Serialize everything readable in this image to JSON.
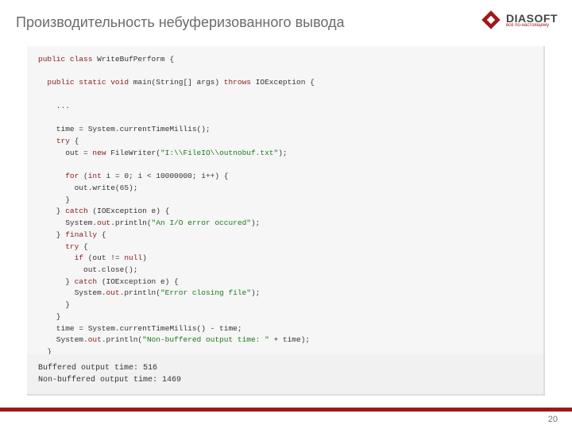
{
  "title": "Производительность небуферизованного вывода",
  "logo": {
    "name": "DIASOFT",
    "tagline": "всё по-настоящему"
  },
  "code": {
    "l01a": "public class",
    "l01b": " WriteBufPerform {",
    "l02a": "  public static void",
    "l02b": " main(String[] args) ",
    "l02c": "throws",
    "l02d": " IOException {",
    "l03": "    ...",
    "l04": "    time = System.currentTimeMillis();",
    "l05a": "    ",
    "l05b": "try",
    "l05c": " {",
    "l06a": "      out = ",
    "l06b": "new",
    "l06c": " FileWriter(",
    "l06d": "\"I:\\\\FileIO\\\\outnobuf.txt\"",
    "l06e": ");",
    "l07a": "      ",
    "l07b": "for",
    "l07c": " (",
    "l07d": "int",
    "l07e": " i = 0; i < 10000000; i++) {",
    "l08": "        out.write(65);",
    "l09": "      }",
    "l10a": "    } ",
    "l10b": "catch",
    "l10c": " (IOException e) {",
    "l11a": "      System.",
    "l11b": "out",
    "l11c": ".println(",
    "l11d": "\"An I/O error occured\"",
    "l11e": ");",
    "l12a": "    } ",
    "l12b": "finally",
    "l12c": " {",
    "l13a": "      ",
    "l13b": "try",
    "l13c": " {",
    "l14a": "        ",
    "l14b": "if",
    "l14c": " (out != ",
    "l14d": "null",
    "l14e": ")",
    "l15": "          out.close();",
    "l16a": "      } ",
    "l16b": "catch",
    "l16c": " (IOException e) {",
    "l17a": "        System.",
    "l17b": "out",
    "l17c": ".println(",
    "l17d": "\"Error closing file\"",
    "l17e": ");",
    "l18": "      }",
    "l19": "    }",
    "l20": "    time = System.currentTimeMillis() - time;",
    "l21a": "    System.",
    "l21b": "out",
    "l21c": ".println(",
    "l21d": "\"Non-buffered output time: \"",
    "l21e": " + time);",
    "l22": "  }",
    "l23": "}"
  },
  "output": {
    "line1": "Buffered output time: 516",
    "line2": "Non-buffered output time: 1469"
  },
  "page": "20"
}
